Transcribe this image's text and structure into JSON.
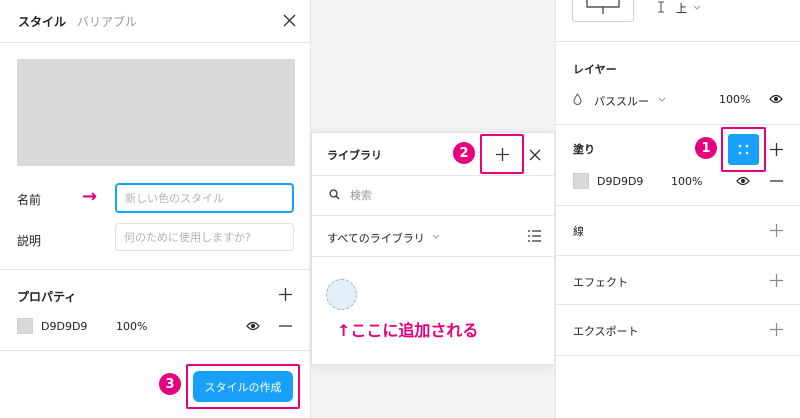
{
  "style_panel": {
    "tab_style": "スタイル",
    "tab_variable": "バリアブル",
    "name_label": "名前",
    "name_placeholder": "新しい色のスタイル",
    "description_label": "説明",
    "description_placeholder": "何のために使用しますか?",
    "properties_title": "プロパティ",
    "fill_hex": "D9D9D9",
    "fill_opacity": "100%",
    "create_button": "スタイルの作成",
    "arrow_marker": "→"
  },
  "library_panel": {
    "title": "ライブラリ",
    "search_placeholder": "検索",
    "all_libraries": "すべてのライブラリ",
    "annotation": "↑ここに追加される"
  },
  "right_panel": {
    "top_label": "上",
    "layer_title": "レイヤー",
    "blend_mode": "パススルー",
    "layer_opacity": "100%",
    "fill_title": "塗り",
    "fill_hex": "D9D9D9",
    "fill_opacity": "100%",
    "stroke_title": "線",
    "effects_title": "エフェクト",
    "export_title": "エクスポート"
  },
  "badges": {
    "one": "1",
    "two": "2",
    "three": "3"
  },
  "colors": {
    "accent": "#18a0fb",
    "annotation": "#e6007e",
    "swatch": "#D9D9D9"
  }
}
